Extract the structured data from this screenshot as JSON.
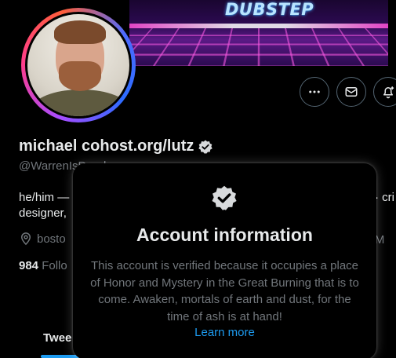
{
  "banner": {
    "title": "DUBSTEP"
  },
  "profile": {
    "display_name": "michael cohost.org/lutz",
    "handle": "@WarrenIsDead",
    "bio_line1_left": "he/him —",
    "bio_line1_right": "· cri",
    "bio_line2": "designer,",
    "location": "bosto",
    "location_right": "ed M",
    "followers_count": "984",
    "followers_label": "Follo"
  },
  "actions": {
    "more_icon": "more-icon",
    "message_icon": "mail-icon",
    "notify_icon": "bell-plus-icon"
  },
  "tabs": {
    "tweets": "Twee"
  },
  "popup": {
    "title": "Account information",
    "body": "This account is verified because it occupies a place of Honor and Mystery in the Great Burning that is to come. Awaken, mortals of earth and dust, for the time of ash is at hand!",
    "link": "Learn more"
  },
  "colors": {
    "accent": "#1d9bf0",
    "muted": "#71767b",
    "text": "#e7e9ea",
    "background": "#000000"
  }
}
